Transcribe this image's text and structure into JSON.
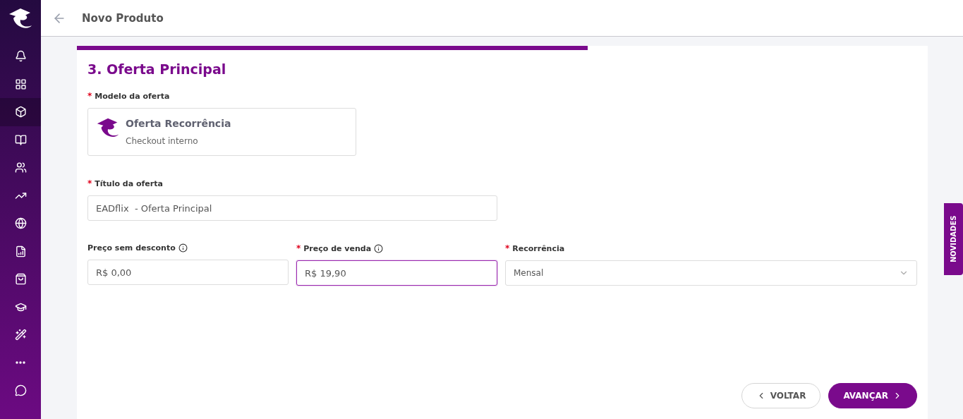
{
  "sidebar": {
    "items": [
      {
        "selected": false
      },
      {
        "selected": false
      },
      {
        "selected": true
      },
      {
        "selected": false
      },
      {
        "selected": false
      },
      {
        "selected": false
      },
      {
        "selected": false
      },
      {
        "selected": false
      },
      {
        "selected": false
      },
      {
        "selected": false
      },
      {
        "selected": false
      },
      {
        "selected": false
      },
      {
        "selected": false
      }
    ]
  },
  "header": {
    "title": "Novo Produto"
  },
  "progress": {
    "level": 0.6
  },
  "section": {
    "title": "3. Oferta Principal"
  },
  "offer_model": {
    "label": "Modelo da oferta",
    "required_mark": "*",
    "title": "Oferta Recorrência",
    "subtitle": "Checkout interno"
  },
  "offer_title": {
    "label": "Título da oferta",
    "required_mark": "*",
    "value": "EADflix  - Oferta Principal"
  },
  "prices": [
    {
      "kind": "input",
      "label": "Preço sem desconto",
      "info": true,
      "value": "R$ 0,00",
      "focused": false
    },
    {
      "kind": "input",
      "label": "Preço de venda",
      "required_mark": "*",
      "info": true,
      "value": "R$ 19,90",
      "focused": true
    },
    {
      "kind": "select",
      "label": "Recorrência",
      "required_mark": "*",
      "info": false,
      "value": "Mensal"
    }
  ],
  "buttons": [
    {
      "kind": "back",
      "label": "VOLTAR"
    },
    {
      "kind": "next",
      "label": "AVANÇAR"
    }
  ],
  "side_tab": {
    "label": "NOVIDADES"
  }
}
